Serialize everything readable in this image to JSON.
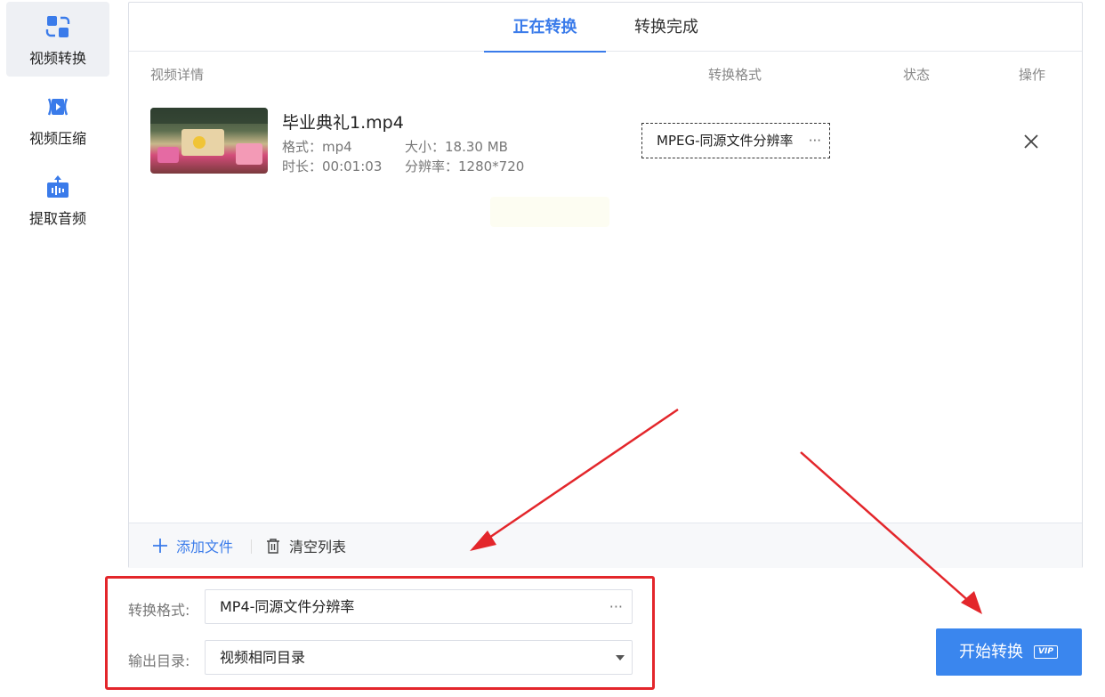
{
  "sidebar": {
    "items": [
      {
        "label": "视频转换",
        "icon": "video-convert-icon",
        "active": true
      },
      {
        "label": "视频压缩",
        "icon": "video-compress-icon",
        "active": false
      },
      {
        "label": "提取音频",
        "icon": "audio-extract-icon",
        "active": false
      }
    ]
  },
  "tabs": [
    {
      "label": "正在转换",
      "active": true
    },
    {
      "label": "转换完成",
      "active": false
    }
  ],
  "table": {
    "headers": {
      "details": "视频详情",
      "format": "转换格式",
      "status": "状态",
      "action": "操作"
    },
    "rows": [
      {
        "file_name": "毕业典礼1.mp4",
        "format_line": "格式：mp4",
        "size_line": "大小：18.30 MB",
        "duration_line": "时长：00:01:03",
        "resolution_line": "分辨率：1280*720",
        "target_format": "MPEG-同源文件分辨率",
        "more": "···"
      }
    ]
  },
  "bottom_bar": {
    "add_label": "添加文件",
    "clear_label": "清空列表"
  },
  "settings": {
    "format_label": "转换格式:",
    "format_value": "MP4-同源文件分辨率",
    "format_more": "···",
    "output_label": "输出目录:",
    "output_value": "视频相同目录"
  },
  "start_button": {
    "label": "开始转换",
    "badge": "VIP"
  },
  "colors": {
    "accent": "#3a7bea",
    "button": "#3a86ee",
    "highlight": "#e3262b"
  }
}
